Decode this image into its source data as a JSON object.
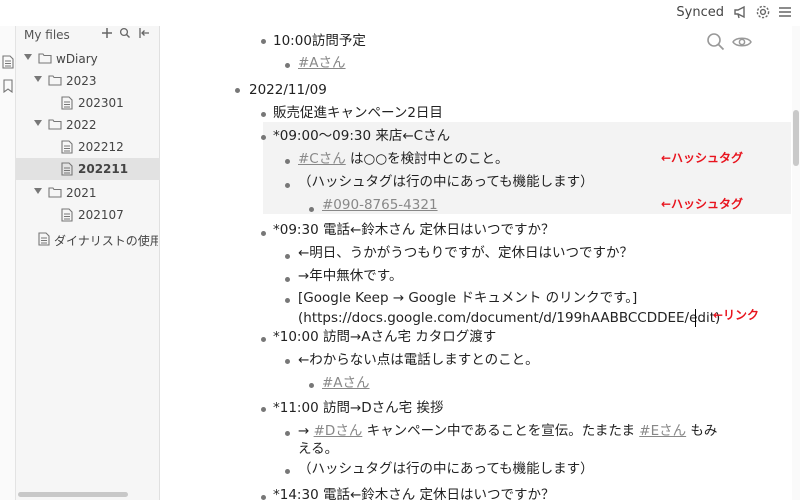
{
  "topbar": {
    "sync_status": "Synced",
    "icons": [
      "megaphone-icon",
      "gear-icon",
      "menu-icon"
    ]
  },
  "sidebar": {
    "title": "My files",
    "header_icons": [
      "plus-icon",
      "search-icon",
      "collapse-sidebar-icon"
    ],
    "tree": [
      {
        "label": "wDiary",
        "type": "folder"
      },
      {
        "label": "2023",
        "type": "folder"
      },
      {
        "label": "202301",
        "type": "file"
      },
      {
        "label": "2022",
        "type": "folder"
      },
      {
        "label": "202212",
        "type": "file"
      },
      {
        "label": "202211",
        "type": "file",
        "selected": true
      },
      {
        "label": "2021",
        "type": "folder"
      },
      {
        "label": "202107",
        "type": "file"
      },
      {
        "label": "ダイナリストの使用",
        "type": "file"
      }
    ]
  },
  "outline": {
    "l01": "10:00訪問予定",
    "l02_tag": "#Aさん",
    "l03": "2022/11/09",
    "l04": "販売促進キャンペーン2日目",
    "l05": "*09:00～09:30 来店←Cさん",
    "l06_tag": "#Cさん",
    "l06_text": " は○○を検討中とのこと。",
    "l07": "（ハッシュタグは行の中にあっても機能します）",
    "l08_tag": "#090-8765-4321",
    "l09": "*09:30 電話←鈴木さん 定休日はいつですか？",
    "l10": "←明日、うかがうつもりですが、定休日はいつですか？",
    "l11": "→年中無休です。",
    "l12a": "[Google Keep → Google ドキュメント のリンクです。]",
    "l12b": "(https://docs.google.com/document/d/199hAABBCCDDEE/edit)",
    "l13": "*10:00 訪問→Aさん宅 カタログ渡す",
    "l14": "←わからない点は電話しますとのこと。",
    "l15_tag": "#Aさん",
    "l16": "*11:00 訪問→Dさん宅 挨拶",
    "l17_pre": "→ ",
    "l17_tag1": "#Dさん",
    "l17_mid": " キャンペーン中であることを宣伝。たまたま ",
    "l17_tag2": "#Eさん",
    "l17_post": " もみ",
    "l17_wrap": "える。",
    "l18": "（ハッシュタグは行の中にあっても機能します）",
    "l19": "*14:30 電話←鈴木さん 定休日はいつですか？"
  },
  "annotations": {
    "a1": "←ハッシュタグ",
    "a2": "←ハッシュタグ",
    "a3": "←リンク"
  },
  "main_tools": [
    "search-icon",
    "eye-icon"
  ],
  "colors": {
    "annotation": "#e8141e",
    "tag": "#888888",
    "selected_row": "#e2e2e2"
  }
}
